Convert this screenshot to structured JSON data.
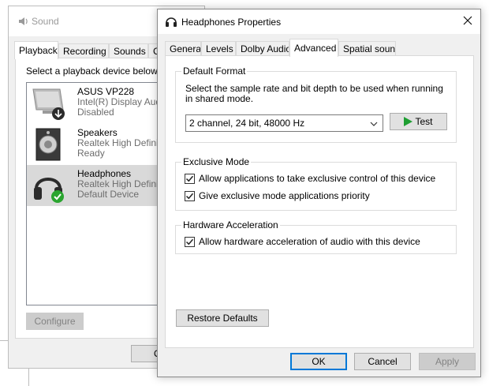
{
  "sound_window": {
    "title": "Sound",
    "tabs": [
      "Playback",
      "Recording",
      "Sounds",
      "Communications"
    ],
    "tab_visible_labels": [
      "Playback",
      "Recording",
      "Sounds",
      "Cor"
    ],
    "prompt": "Select a playback device below to",
    "devices": [
      {
        "name": "ASUS VP228",
        "line1": "Intel(R) Display Audi",
        "line2": "Disabled",
        "icon": "monitor-icon",
        "selected": false
      },
      {
        "name": "Speakers",
        "line1": "Realtek High Definit",
        "line2": "Ready",
        "icon": "speaker-icon",
        "selected": false
      },
      {
        "name": "Headphones",
        "line1": "Realtek High Definit",
        "line2": "Default Device",
        "icon": "headphones-icon",
        "selected": true
      }
    ],
    "configure_label": "Configure",
    "ok_label": "O"
  },
  "properties_window": {
    "title": "Headphones Properties",
    "close_glyph": "✕",
    "tabs": [
      "General",
      "Levels",
      "Dolby Audio",
      "Advanced",
      "Spatial sound"
    ],
    "active_tab": "Advanced",
    "default_format": {
      "title": "Default Format",
      "description": "Select the sample rate and bit depth to be used when running in shared mode.",
      "selected": "2 channel, 24 bit, 48000 Hz",
      "test_label": "Test"
    },
    "exclusive_mode": {
      "title": "Exclusive Mode",
      "options": [
        {
          "label": "Allow applications to take exclusive control of this device",
          "checked": true
        },
        {
          "label": "Give exclusive mode applications priority",
          "checked": true
        }
      ]
    },
    "hardware_acceleration": {
      "title": "Hardware Acceleration",
      "options": [
        {
          "label": "Allow hardware acceleration of audio with this device",
          "checked": true
        }
      ]
    },
    "restore_label": "Restore Defaults",
    "buttons": {
      "ok": "OK",
      "cancel": "Cancel",
      "apply": "Apply"
    }
  },
  "colors": {
    "accent": "#0078d7",
    "play_green": "#1e9e32",
    "check_green": "#2aa52f",
    "selection": "#d9d9d9"
  }
}
